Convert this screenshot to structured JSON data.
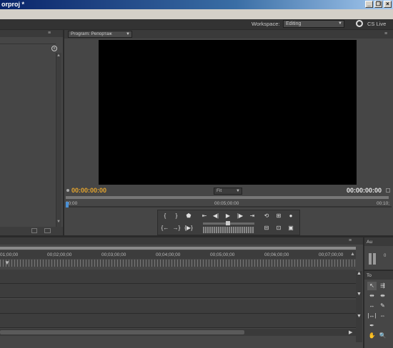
{
  "window": {
    "title": "orproj *",
    "min_label": "_",
    "restore_label": "❐",
    "close_label": "×"
  },
  "workspace": {
    "label": "Workspace:",
    "selected": "Editing",
    "cs_live_label": "CS Live"
  },
  "program_monitor": {
    "tab_label": "Program: Репортаж",
    "timecode_current": "00:00:00:00",
    "fit_selected": "Fit",
    "timecode_duration": "00:00:00:00",
    "ruler_labels": [
      "00:00",
      "00:05;00:00",
      "00:10;"
    ]
  },
  "timeline": {
    "time_labels": [
      "01;00;00",
      "00;02;00;00",
      "00;03;00;00",
      "00;04;00;00",
      "00;05;00;00",
      "00;06;00;00",
      "00;07;00;00"
    ]
  },
  "audio_meters": {
    "tab_label": "Au",
    "scale_label": "0"
  },
  "tools": {
    "tab_label": "To"
  },
  "colors": {
    "panel_bg": "#464646",
    "timecode_accent": "#e6a52e",
    "titlebar_start": "#0a246a",
    "titlebar_end": "#a6caf0"
  }
}
